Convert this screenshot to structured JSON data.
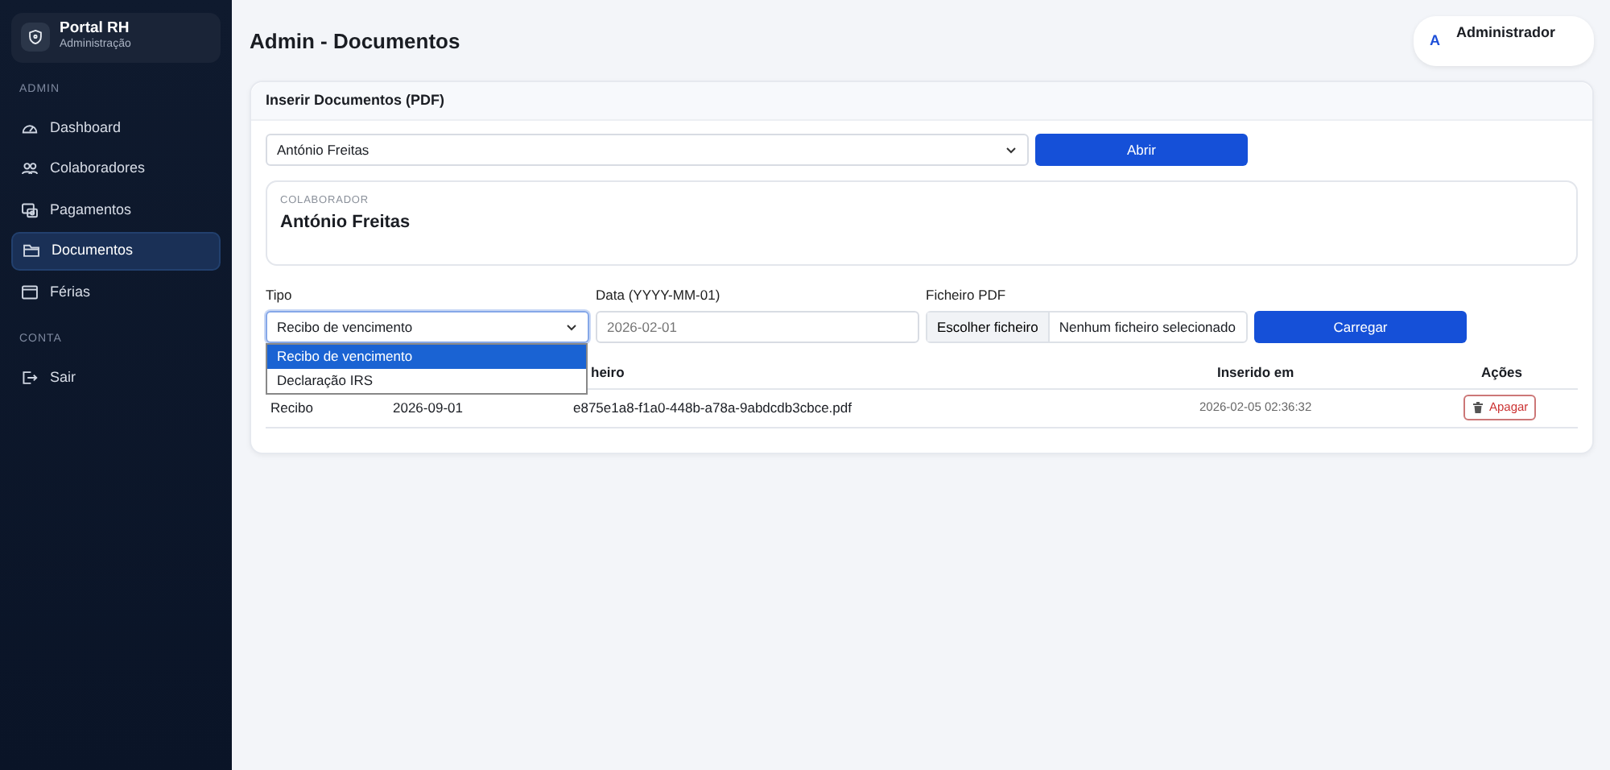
{
  "sidebar": {
    "brand": {
      "title": "Portal RH",
      "subtitle": "Administração"
    },
    "sections": [
      {
        "heading": "ADMIN",
        "items": [
          {
            "label": "Dashboard",
            "selected": false
          },
          {
            "label": "Colaboradores",
            "selected": false
          },
          {
            "label": "Pagamentos",
            "selected": false
          },
          {
            "label": "Documentos",
            "selected": true
          },
          {
            "label": "Férias",
            "selected": false
          }
        ]
      },
      {
        "heading": "CONTA",
        "items": [
          {
            "label": "Sair",
            "selected": false
          }
        ]
      }
    ]
  },
  "header": {
    "title": "Admin - Documentos",
    "user": {
      "initial": "A",
      "name": "Administrador"
    }
  },
  "card": {
    "title": "Inserir Documentos (PDF)",
    "employee_select": {
      "value": "António Freitas"
    },
    "open_button": "Abrir",
    "collaborator": {
      "label": "COLABORADOR",
      "name": "António Freitas"
    },
    "form": {
      "type": {
        "label": "Tipo",
        "value": "Recibo de vencimento",
        "expanded": true,
        "options": [
          {
            "label": "Recibo de vencimento",
            "selected": true
          },
          {
            "label": "Declaração IRS",
            "selected": false
          }
        ]
      },
      "date": {
        "label": "Data (YYYY-MM-01)",
        "placeholder": "2026-02-01"
      },
      "file": {
        "label": "Ficheiro PDF",
        "button": "Escolher ficheiro",
        "status": "Nenhum ficheiro selecionado"
      },
      "upload_button": "Carregar"
    },
    "table": {
      "columns": [
        "",
        "",
        "heiro",
        "Inserido em",
        "Ações"
      ],
      "rows": [
        {
          "cells": [
            "Recibo",
            "2026-09-01",
            "e875e1a8-f1a0-448b-a78a-9abdcdb3cbce.pdf",
            "2026-02-05 02:36:32"
          ],
          "action": "Apagar"
        }
      ]
    }
  }
}
